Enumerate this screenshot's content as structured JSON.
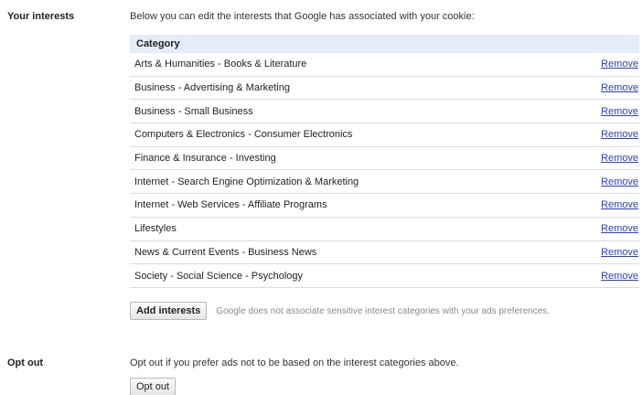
{
  "interests": {
    "section_label": "Your interests",
    "intro": "Below you can edit the interests that Google has associated with your cookie:",
    "table_header": "Category",
    "remove_label": "Remove",
    "categories": [
      "Arts & Humanities - Books & Literature",
      "Business - Advertising & Marketing",
      "Business - Small Business",
      "Computers & Electronics - Consumer Electronics",
      "Finance & Insurance - Investing",
      "Internet - Search Engine Optimization & Marketing",
      "Internet - Web Services - Affiliate Programs",
      "Lifestyles",
      "News & Current Events - Business News",
      "Society - Social Science - Psychology"
    ],
    "add_button": "Add interests",
    "add_note": "Google does not associate sensitive interest categories with your ads preferences."
  },
  "optout": {
    "section_label": "Opt out",
    "text": "Opt out if you prefer ads not to be based on the interest categories above.",
    "button": "Opt out"
  },
  "colors": {
    "header_bg": "#e5ecf9",
    "link": "#2a40c8"
  }
}
